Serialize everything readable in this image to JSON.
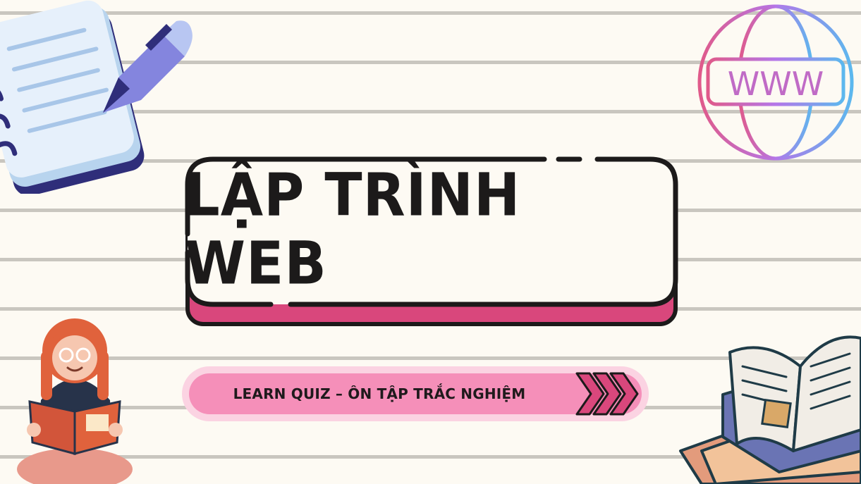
{
  "slide": {
    "title": "LẬP TRÌNH WEB",
    "subtitle": "LEARN QUIZ – ÔN TẬP TRẮC NGHIỆM",
    "globe_label": "WWW"
  },
  "colors": {
    "background": "#fdfaf3",
    "ruled_line": "#c9c6bf",
    "accent_pink": "#d9477c",
    "pill": "#f58fb9",
    "ink": "#1c1a1a"
  },
  "icons": [
    "notepad-icon",
    "pen-icon",
    "globe-www-icon",
    "reading-girl-illustration",
    "open-books-illustration",
    "forward-chevrons-icon"
  ]
}
